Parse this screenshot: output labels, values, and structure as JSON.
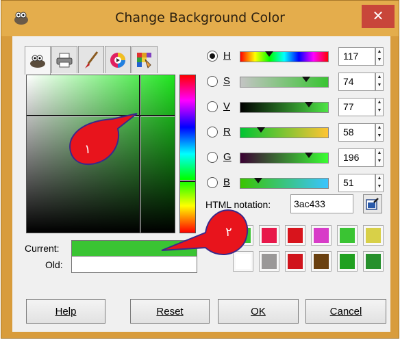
{
  "window": {
    "title": "Change Background Color",
    "close_glyph": "✕",
    "app_icon": "gimp-icon"
  },
  "tabs": [
    {
      "icon": "gimp-wilber-icon",
      "active": true
    },
    {
      "icon": "printer-icon",
      "active": false
    },
    {
      "icon": "paintbrush-icon",
      "active": false
    },
    {
      "icon": "color-wheel-icon",
      "active": false
    },
    {
      "icon": "palette-icon",
      "active": false
    }
  ],
  "channels": [
    {
      "key": "H",
      "label": "H",
      "value": "117",
      "selected": true,
      "level": 0.325
    },
    {
      "key": "S",
      "label": "S",
      "value": "74",
      "selected": false,
      "level": 0.74
    },
    {
      "key": "V",
      "label": "V",
      "value": "77",
      "selected": false,
      "level": 0.77
    },
    {
      "key": "R",
      "label": "R",
      "value": "58",
      "selected": false,
      "level": 0.227
    },
    {
      "key": "G",
      "label": "G",
      "value": "196",
      "selected": false,
      "level": 0.769
    },
    {
      "key": "B",
      "label": "B",
      "value": "51",
      "selected": false,
      "level": 0.2
    }
  ],
  "html_notation": {
    "label": "HTML notation:",
    "value": "3ac433"
  },
  "current_label": "Current:",
  "old_label": "Old:",
  "current_color": "#3ac433",
  "old_color": "#ffffff",
  "history_colors": [
    [
      "#3ac433",
      "#e8184a",
      "#d8141c",
      "#d83cc8",
      "#3ac433",
      "#d8d048"
    ],
    [
      "#ffffff",
      "#9a9898",
      "#d0141c",
      "#6a4010",
      "#20a020",
      "#26902c"
    ]
  ],
  "buttons": {
    "help": "Help",
    "reset": "Reset",
    "ok": "OK",
    "cancel": "Cancel"
  },
  "annotations": [
    {
      "label": "١",
      "color": "#e8141c"
    },
    {
      "label": "٢",
      "color": "#e8141c"
    }
  ]
}
